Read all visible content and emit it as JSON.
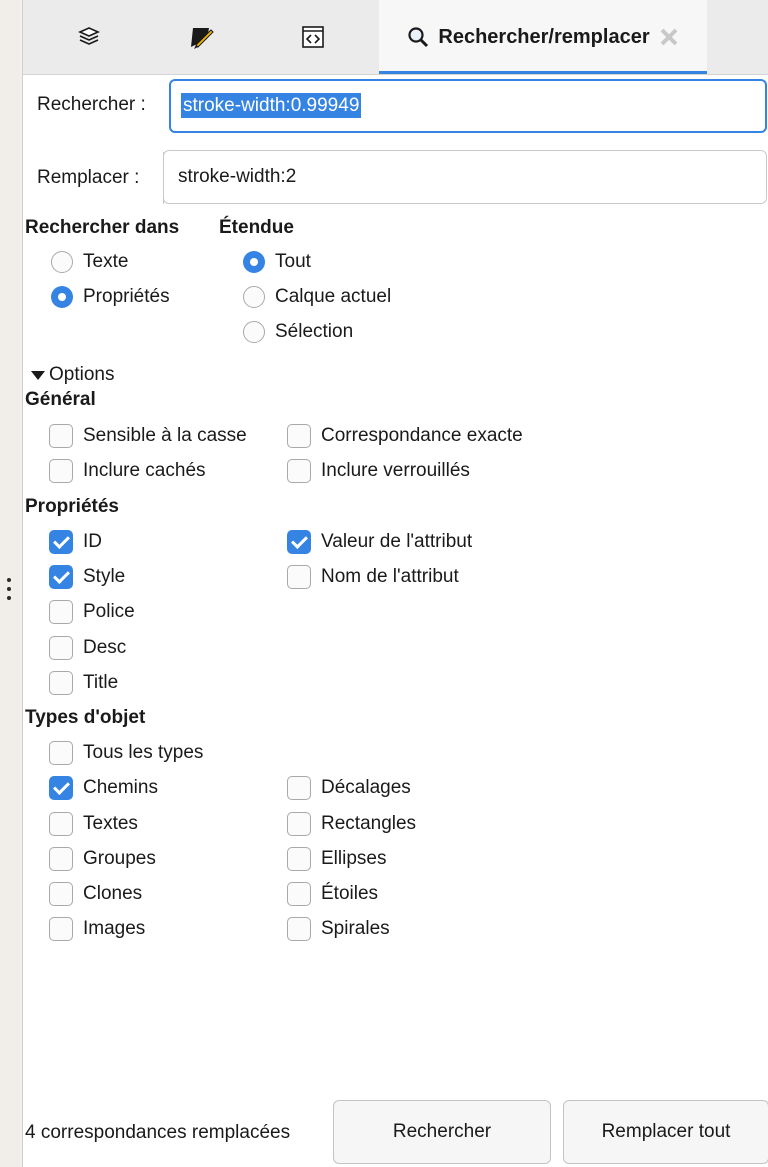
{
  "tabs": [
    {
      "icon": "layers-icon"
    },
    {
      "icon": "fill-stroke-icon"
    },
    {
      "icon": "xml-editor-icon"
    },
    {
      "icon": "search-icon",
      "label": "Rechercher/remplacer",
      "close_icon": "close-icon",
      "active": true
    }
  ],
  "search": {
    "label": "Rechercher :",
    "value": "stroke-width:0.99949"
  },
  "replace": {
    "label": "Remplacer :",
    "value": "stroke-width:2"
  },
  "search_in": {
    "heading": "Rechercher dans",
    "options": [
      {
        "label": "Texte",
        "selected": false
      },
      {
        "label": "Propriétés",
        "selected": true
      }
    ]
  },
  "scope": {
    "heading": "Étendue",
    "options": [
      {
        "label": "Tout",
        "selected": true
      },
      {
        "label": "Calque actuel",
        "selected": false
      },
      {
        "label": "Sélection",
        "selected": false
      }
    ]
  },
  "options_expander": {
    "label": "Options",
    "expanded": true
  },
  "general": {
    "heading": "Général",
    "items": [
      {
        "label": "Sensible à la casse",
        "checked": false
      },
      {
        "label": "Correspondance exacte",
        "checked": false
      },
      {
        "label": "Inclure cachés",
        "checked": false
      },
      {
        "label": "Inclure verrouillés",
        "checked": false
      }
    ]
  },
  "properties": {
    "heading": "Propriétés",
    "items": [
      {
        "label": "ID",
        "checked": true
      },
      {
        "label": "Valeur de l'attribut",
        "checked": true
      },
      {
        "label": "Style",
        "checked": true
      },
      {
        "label": "Nom de l'attribut",
        "checked": false
      },
      {
        "label": "Police",
        "checked": false
      },
      {
        "label": "Desc",
        "checked": false
      },
      {
        "label": "Title",
        "checked": false
      }
    ]
  },
  "object_types": {
    "heading": "Types d'objet",
    "items": [
      {
        "label": "Tous les types",
        "checked": false
      },
      {
        "label": "Chemins",
        "checked": true
      },
      {
        "label": "Décalages",
        "checked": false
      },
      {
        "label": "Textes",
        "checked": false
      },
      {
        "label": "Rectangles",
        "checked": false
      },
      {
        "label": "Groupes",
        "checked": false
      },
      {
        "label": "Ellipses",
        "checked": false
      },
      {
        "label": "Clones",
        "checked": false
      },
      {
        "label": "Étoiles",
        "checked": false
      },
      {
        "label": "Images",
        "checked": false
      },
      {
        "label": "Spirales",
        "checked": false
      }
    ]
  },
  "status": "4 correspondances remplacées",
  "buttons": {
    "find": "Rechercher",
    "replace_all": "Remplacer tout"
  },
  "colors": {
    "accent": "#3584e4"
  }
}
